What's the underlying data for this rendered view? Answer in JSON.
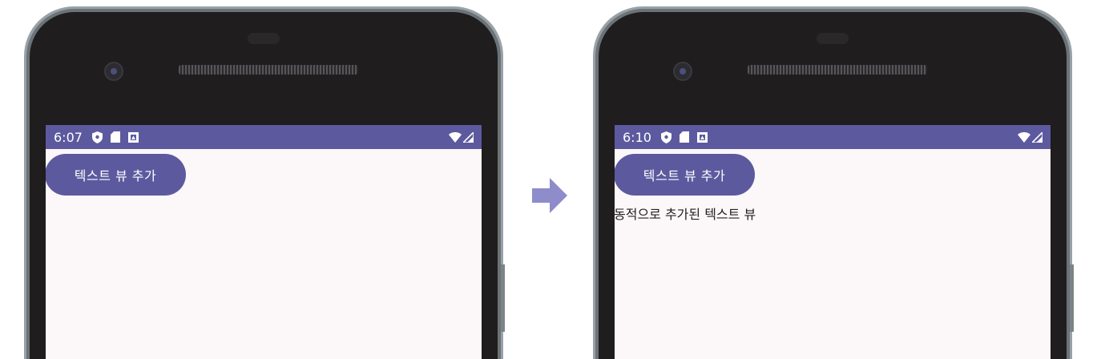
{
  "before": {
    "status_time": "6:07",
    "button_label": "텍스트 뷰 추가"
  },
  "after": {
    "status_time": "6:10",
    "button_label": "텍스트 뷰 추가",
    "added_text": "동적으로 추가된 텍스트 뷰"
  },
  "colors": {
    "accent": "#5d599f",
    "screen_bg": "#fcf7f8",
    "bezel": "#1f1d1e",
    "arrow": "#8e8ccb"
  },
  "icons": [
    "shield-icon",
    "sd-card-icon",
    "notification-icon",
    "wifi-icon",
    "signal-icon",
    "right-arrow-icon"
  ]
}
